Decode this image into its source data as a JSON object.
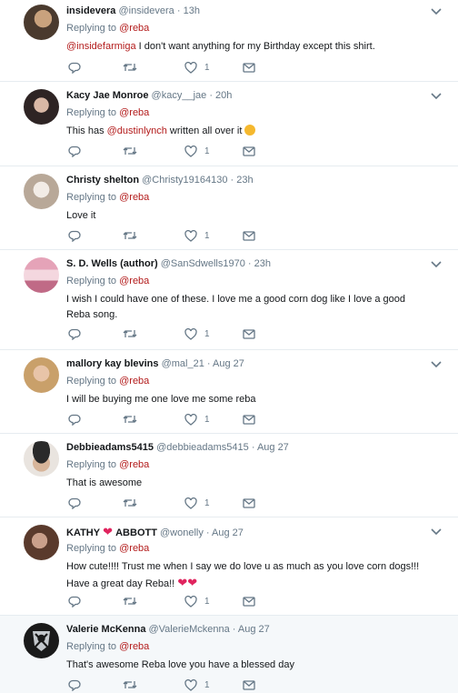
{
  "tweets": [
    {
      "name": "insidevera",
      "handle": "@insidevera",
      "time": "13h",
      "replying_label": "Replying to",
      "replying_to": "@reba",
      "text_parts": [
        "@insidefarmiga",
        " I don't want anything for my Birthday except this shirt."
      ],
      "likes": "1",
      "avatar_icon": "avatar-photo"
    },
    {
      "name": "Kacy Jae Monroe",
      "handle": "@kacy__jae",
      "time": "20h",
      "replying_label": "Replying to",
      "replying_to": "@reba",
      "text_parts": [
        "This has ",
        "@dustinlynch",
        " written all over it"
      ],
      "likes": "1",
      "avatar_icon": "avatar-photo",
      "emoji": "winking-face"
    },
    {
      "name": "Christy shelton",
      "handle": "@Christy19164130",
      "time": "23h",
      "replying_label": "Replying to",
      "replying_to": "@reba",
      "text": "Love it",
      "likes": "1",
      "avatar_icon": "avatar-photo"
    },
    {
      "name": "S. D. Wells (author)",
      "handle": "@SanSdwells1970",
      "time": "23h",
      "replying_label": "Replying to",
      "replying_to": "@reba",
      "text": "I wish I could have one of these. I love me a good corn dog like I love a good Reba song.",
      "likes": "1",
      "avatar_icon": "avatar-photo"
    },
    {
      "name": "mallory kay blevins",
      "handle": "@mal_21",
      "time": "Aug 27",
      "replying_label": "Replying to",
      "replying_to": "@reba",
      "text": "I will be buying me one love me some reba",
      "likes": "1",
      "avatar_icon": "avatar-photo"
    },
    {
      "name": "Debbieadams5415",
      "handle": "@debbieadams5415",
      "time": "Aug 27",
      "replying_label": "Replying to",
      "replying_to": "@reba",
      "text": "That is awesome",
      "likes": "1",
      "avatar_icon": "avatar-photo"
    },
    {
      "name_parts": [
        "KATHY",
        "ABBOTT"
      ],
      "handle": "@wonelly",
      "time": "Aug 27",
      "replying_label": "Replying to",
      "replying_to": "@reba",
      "text": "How cute!!!! Trust me when I say we do love u as much as you love corn dogs!!! Have a great day Reba!!",
      "likes": "1",
      "avatar_icon": "avatar-photo",
      "emoji": "red-heart"
    },
    {
      "name": "Valerie McKenna",
      "handle": "@ValerieMckenna",
      "time": "Aug 27",
      "replying_label": "Replying to",
      "replying_to": "@reba",
      "text": "That's awesome Reba love you have a blessed day",
      "likes": "1",
      "avatar_icon": "raiders-logo"
    }
  ],
  "separator": "·",
  "colors": {
    "link": "#b31b1b",
    "muted": "#657786",
    "text": "#14171a",
    "divider": "#e6ecf0",
    "highlight_bg": "#f5f8fa"
  },
  "icons": [
    "chevron-down-icon",
    "reply-icon",
    "retweet-icon",
    "like-icon",
    "message-icon"
  ]
}
